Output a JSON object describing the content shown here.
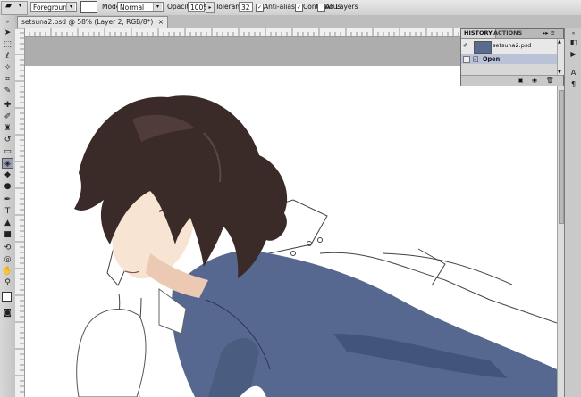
{
  "options_bar": {
    "fill_source": "Foreground",
    "mode_label": "Mode:",
    "mode_value": "Normal",
    "opacity_label": "Opacity:",
    "opacity_value": "100%",
    "tolerance_label": "Tolerance:",
    "tolerance_value": "32",
    "anti_alias_label": "Anti-alias",
    "anti_alias_checked": true,
    "contiguous_label": "Contiguous",
    "contiguous_checked": true,
    "all_layers_label": "All Layers",
    "all_layers_checked": false
  },
  "document": {
    "tab_title": "setsuna2.psd @ 58% (Layer 2, RGB/8*)",
    "close_glyph": "×"
  },
  "history_panel": {
    "tabs": [
      "HISTORY",
      "ACTIONS"
    ],
    "active_tab": "HISTORY",
    "menu_glyph": "▸▸ ≡",
    "snapshot_name": "setsuna2.psd",
    "states": [
      {
        "label": "Open",
        "selected": true
      }
    ]
  },
  "colors": {
    "coat": "#56688f",
    "coat_shadow": "#3f4f74",
    "hair": "#3a2a28",
    "skin": "#f7e4d2",
    "history_selected": "#b9c2d6"
  }
}
